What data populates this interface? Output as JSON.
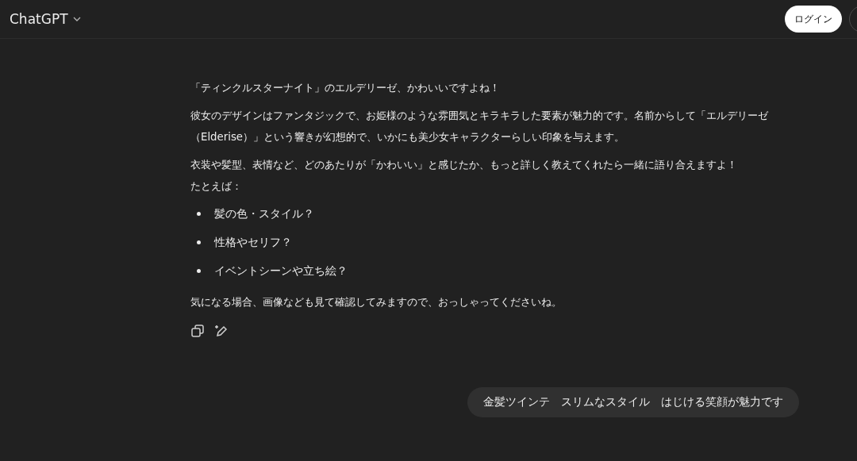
{
  "header": {
    "title": "ChatGPT",
    "login_button": "ログイン"
  },
  "assistant_message": {
    "paragraphs": [
      {
        "kind": "text",
        "lines": [
          "「ティンクルスターナイト」のエルデリーゼ、かわいいですよね！"
        ]
      },
      {
        "kind": "text",
        "lines": [
          "彼女のデザインはファンタジックで、お姫様のような雰囲気とキラキラした要素が魅力的です。名前からして「エルデリーゼ（Elderise）」という響きが幻想的で、いかにも美少女キャラクターらしい印象を与えます。"
        ]
      },
      {
        "kind": "text",
        "lines": [
          "衣装や髪型、表情など、どのあたりが「かわいい」と感じたか、もっと詳しく教えてくれたら一緒に語り合えますよ！",
          "たとえば："
        ]
      },
      {
        "kind": "list",
        "items": [
          "髪の色・スタイル？",
          "性格やセリフ？",
          "イベントシーンや立ち絵？"
        ]
      },
      {
        "kind": "text",
        "lines": [
          "気になる場合、画像なども見て確認してみますので、おっしゃってくださいね。"
        ]
      }
    ]
  },
  "user_message": {
    "text": "金髪ツインテ　スリムなスタイル　はじける笑顔が魅力です"
  }
}
